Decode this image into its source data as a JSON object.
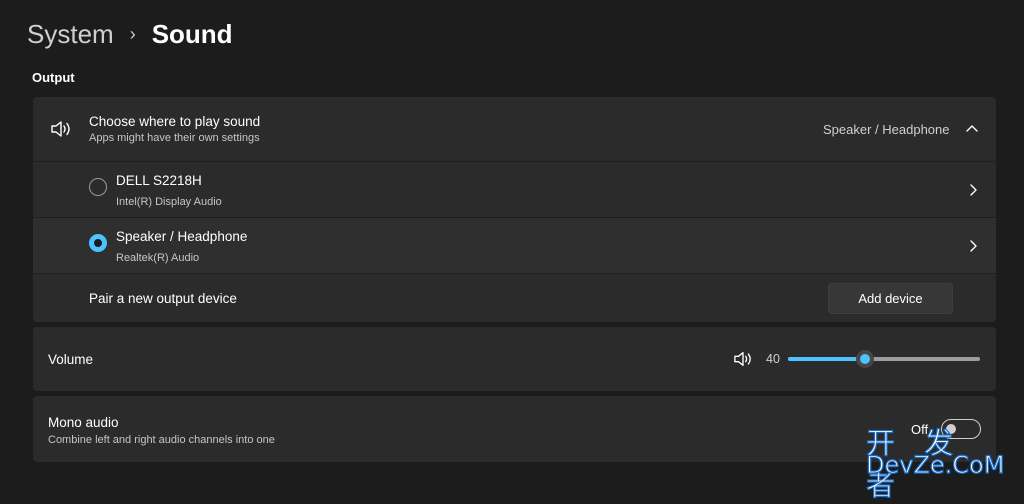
{
  "breadcrumb": {
    "parent": "System",
    "separator": "›",
    "current": "Sound"
  },
  "output": {
    "section_label": "Output",
    "choose": {
      "title": "Choose where to play sound",
      "subtitle": "Apps might have their own settings",
      "selected_value": "Speaker / Headphone",
      "icon": "speaker-icon",
      "expanded": true
    },
    "devices": [
      {
        "name": "DELL S2218H",
        "driver": "Intel(R) Display Audio",
        "selected": false
      },
      {
        "name": "Speaker / Headphone",
        "driver": "Realtek(R) Audio",
        "selected": true
      }
    ],
    "pair": {
      "label": "Pair a new output device",
      "button_label": "Add device"
    }
  },
  "volume": {
    "label": "Volume",
    "value": 40,
    "value_text": "40",
    "icon": "volume-icon"
  },
  "mono_audio": {
    "title": "Mono audio",
    "subtitle": "Combine left and right audio channels into one",
    "state_text": "Off",
    "on": false
  },
  "watermark": {
    "chinese": "开 发 者",
    "latin": "DevZe.CoM"
  },
  "colors": {
    "accent": "#4cc2ff",
    "background": "#1c1c1c",
    "card": "#2b2b2b"
  }
}
